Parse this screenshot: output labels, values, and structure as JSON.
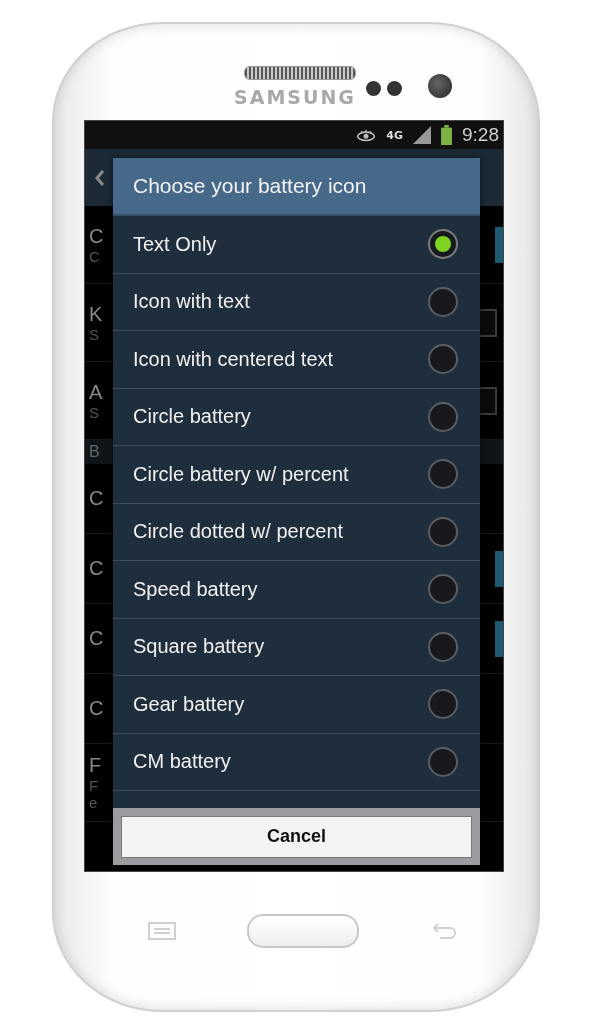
{
  "device": {
    "brand": "SAMSUNG"
  },
  "status_bar": {
    "network": "4G",
    "time": "9:28"
  },
  "background_rows": [
    {
      "kind": "toggle",
      "title": "C",
      "subtitle": "C",
      "on": true
    },
    {
      "kind": "checkbox",
      "title": "K",
      "subtitle": "S",
      "checked": false
    },
    {
      "kind": "checkbox",
      "title": "A",
      "subtitle": "S",
      "checked": false
    },
    {
      "kind": "header",
      "title": "B"
    },
    {
      "kind": "plain",
      "title": "C"
    },
    {
      "kind": "toggle",
      "title": "C",
      "on": true
    },
    {
      "kind": "toggle",
      "title": "C",
      "on": true
    },
    {
      "kind": "plain",
      "title": "C"
    },
    {
      "kind": "plain",
      "title": "F",
      "subtitle": "F",
      "extra": "e"
    }
  ],
  "dialog": {
    "title": "Choose your battery icon",
    "options": [
      {
        "label": "Text Only",
        "selected": true
      },
      {
        "label": "Icon with text",
        "selected": false
      },
      {
        "label": "Icon with centered text",
        "selected": false
      },
      {
        "label": "Circle battery",
        "selected": false
      },
      {
        "label": "Circle battery w/ percent",
        "selected": false
      },
      {
        "label": "Circle dotted w/ percent",
        "selected": false
      },
      {
        "label": "Speed battery",
        "selected": false
      },
      {
        "label": "Square battery",
        "selected": false
      },
      {
        "label": "Gear battery",
        "selected": false
      },
      {
        "label": "CM battery",
        "selected": false
      }
    ],
    "cancel": "Cancel"
  }
}
